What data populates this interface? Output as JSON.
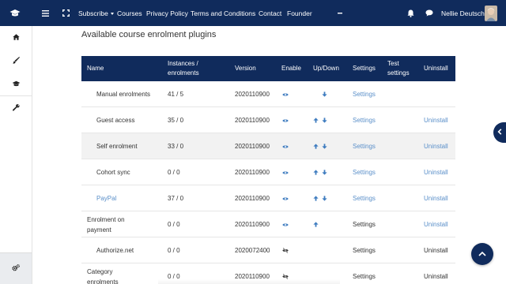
{
  "navbar": {
    "links": [
      "Subscribe",
      "Courses",
      "Privacy Policy",
      "Terms and Conditions",
      "Contact",
      "Founder"
    ],
    "user_name": "Nellie Deutsch"
  },
  "main": {
    "heading": "Available course enrolment plugins"
  },
  "table": {
    "headers": {
      "name": "Name",
      "instances": "Instances / enrolments",
      "version": "Version",
      "enable": "Enable",
      "updown": "Up/Down",
      "settings": "Settings",
      "test": "Test settings",
      "uninstall": "Uninstall"
    },
    "rows": [
      {
        "name": "Manual enrolments",
        "instances": "41 / 5",
        "version": "2020110900",
        "enabled": true,
        "up": false,
        "down": true,
        "settings": "Settings",
        "settings_link": true,
        "uninstall": "",
        "uninstall_link": false,
        "name_link": false
      },
      {
        "name": "Guest access",
        "instances": "35 / 0",
        "version": "2020110900",
        "enabled": true,
        "up": true,
        "down": true,
        "settings": "Settings",
        "settings_link": true,
        "uninstall": "Uninstall",
        "uninstall_link": true,
        "name_link": false
      },
      {
        "name": "Self enrolment",
        "instances": "33 / 0",
        "version": "2020110900",
        "enabled": true,
        "up": true,
        "down": true,
        "settings": "Settings",
        "settings_link": true,
        "uninstall": "Uninstall",
        "uninstall_link": true,
        "name_link": false
      },
      {
        "name": "Cohort sync",
        "instances": "0 / 0",
        "version": "2020110900",
        "enabled": true,
        "up": true,
        "down": true,
        "settings": "Settings",
        "settings_link": true,
        "uninstall": "Uninstall",
        "uninstall_link": true,
        "name_link": false
      },
      {
        "name": "PayPal",
        "instances": "37 / 0",
        "version": "2020110900",
        "enabled": true,
        "up": true,
        "down": true,
        "settings": "Settings",
        "settings_link": true,
        "uninstall": "Uninstall",
        "uninstall_link": true,
        "name_link": true
      },
      {
        "name": "Enrolment on payment",
        "instances": "0 / 0",
        "version": "2020110900",
        "enabled": true,
        "up": true,
        "down": false,
        "settings": "Settings",
        "settings_link": false,
        "uninstall": "Uninstall",
        "uninstall_link": true,
        "name_link": false
      },
      {
        "name": "Authorize.net",
        "instances": "0 / 0",
        "version": "2020072400",
        "enabled": false,
        "up": false,
        "down": false,
        "settings": "Settings",
        "settings_link": false,
        "uninstall": "Uninstall",
        "uninstall_link": false,
        "name_link": false
      },
      {
        "name": "Category enrolments",
        "instances": "0 / 0",
        "version": "2020110900",
        "enabled": false,
        "up": false,
        "down": false,
        "settings": "Settings",
        "settings_link": false,
        "uninstall": "Uninstall",
        "uninstall_link": false,
        "name_link": false
      }
    ]
  },
  "colors": {
    "navbar": "#102b5c",
    "link": "#5a8fc9",
    "accent": "#3d7bbf"
  },
  "icons": {
    "brand": "graduation-cap-icon",
    "menu": "hamburger-icon",
    "fullscreen": "expand-icon",
    "notifications": "bell-icon",
    "messages": "chat-bubble-icon",
    "sidebar": [
      "home-icon",
      "brush-icon",
      "graduation-cap-icon",
      "wrench-icon",
      "cogs-icon"
    ],
    "enable": "eye-icon",
    "disabled": "eye-slash-icon",
    "up": "arrow-up-icon",
    "down": "arrow-down-icon",
    "drawer": "chevron-left-icon",
    "back_to_top": "chevron-up-icon"
  }
}
